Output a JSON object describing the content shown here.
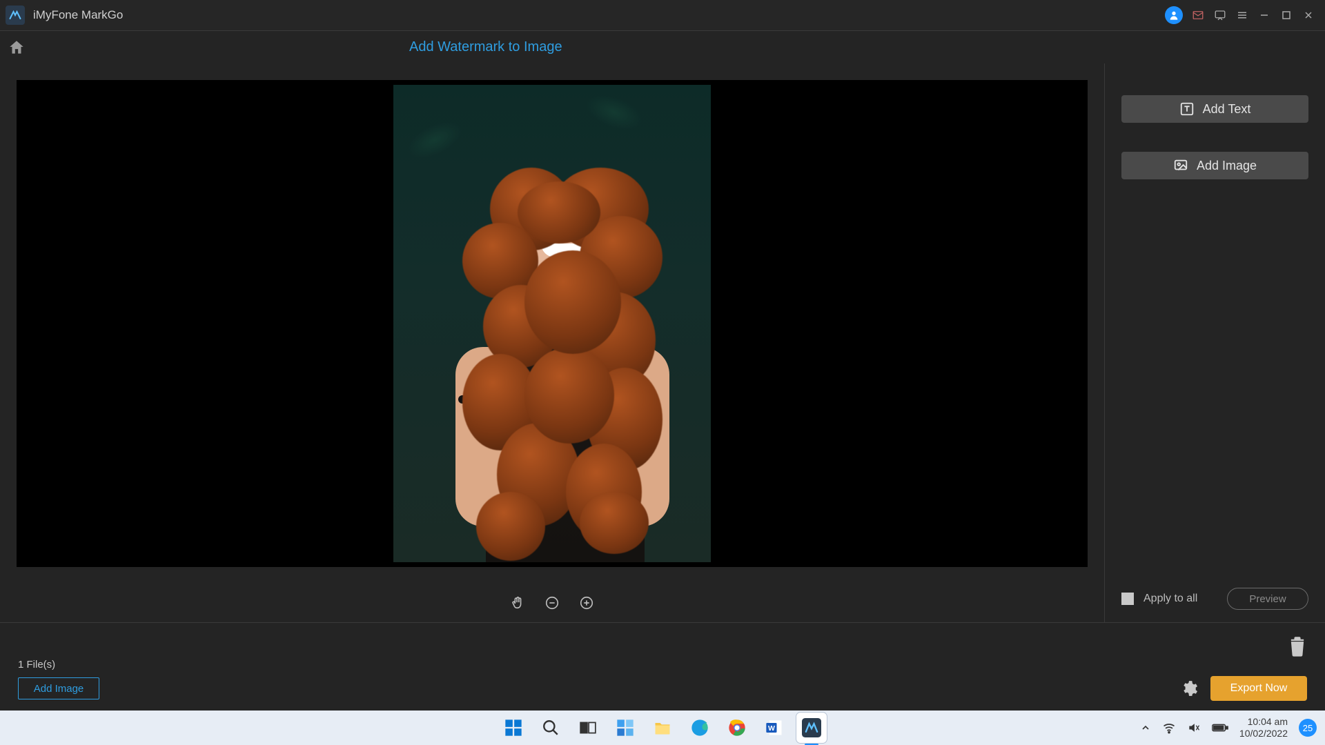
{
  "app": {
    "title": "iMyFone MarkGo",
    "titlebar_icons": [
      "account",
      "mail",
      "feedback",
      "menu",
      "minimize",
      "maximize",
      "close"
    ]
  },
  "page": {
    "title": "Add Watermark to Image"
  },
  "canvas": {
    "image_description": "Portrait of a smiling young woman with long curly red hair, bare shoulders, dark leafy background",
    "tools": [
      "hand",
      "zoom-out",
      "zoom-in"
    ]
  },
  "right_panel": {
    "add_text_label": "Add Text",
    "add_image_label": "Add Image",
    "apply_to_all_label": "Apply to all",
    "apply_to_all_checked": false,
    "preview_label": "Preview",
    "preview_enabled": false
  },
  "bottom": {
    "file_count_label": "1 File(s)",
    "add_image_label": "Add Image",
    "export_label": "Export Now"
  },
  "taskbar": {
    "apps": [
      "start",
      "search",
      "task-view",
      "widgets",
      "explorer",
      "edge",
      "chrome",
      "word",
      "markgo"
    ],
    "active_app": "markgo",
    "clock_time": "10:04 am",
    "clock_date": "10/02/2022",
    "notification_count": "25"
  }
}
